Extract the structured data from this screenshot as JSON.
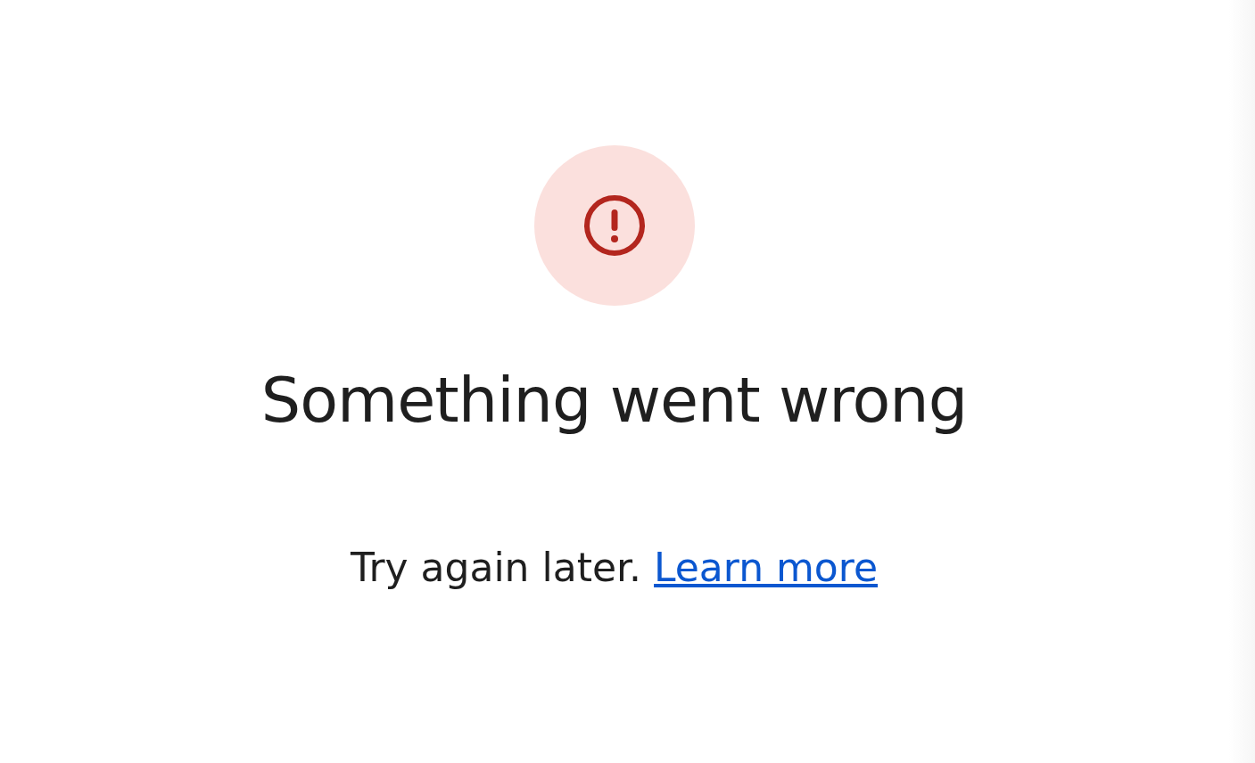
{
  "error": {
    "title": "Something went wrong",
    "message": "Try again later.",
    "link": "Learn more"
  }
}
